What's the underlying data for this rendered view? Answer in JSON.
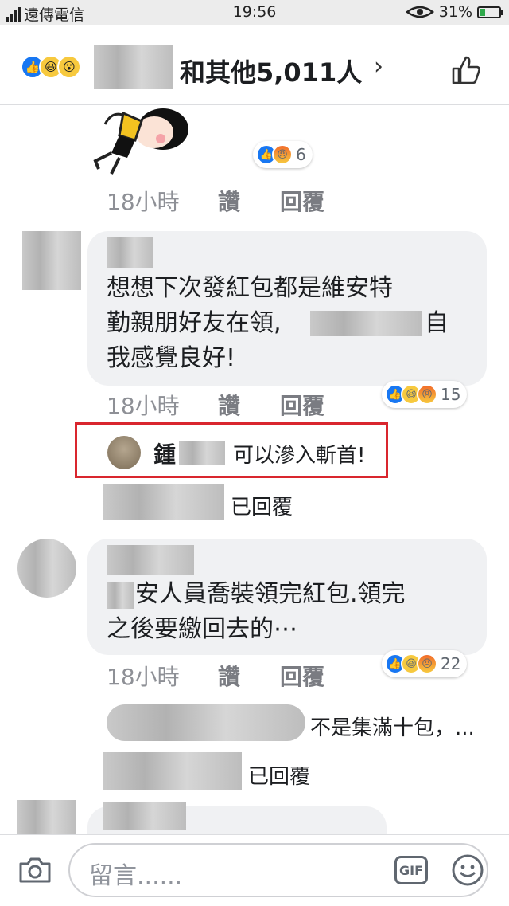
{
  "status_bar": {
    "carrier": "遠傳電信",
    "time": "19:56",
    "battery": "31%",
    "battery_fraction": 0.31
  },
  "header": {
    "likes_summary": "和其他5,011人",
    "chevron": "›",
    "reactions": [
      "like-icon",
      "haha-icon",
      "wow-icon"
    ]
  },
  "comments": [
    {
      "time": "18小時",
      "like_label": "讚",
      "reply_label": "回覆",
      "reaction_count": "6",
      "reactions": [
        "like-icon",
        "angry-icon"
      ]
    },
    {
      "line1": "想想下次發紅包都是維安特",
      "line2a": "勤親朋好友在領,",
      "line2b": "自",
      "line3": "我感覺良好!",
      "time": "18小時",
      "like_label": "讚",
      "reply_label": "回覆",
      "reaction_count": "15",
      "reactions": [
        "like-icon",
        "haha-icon",
        "angry-icon"
      ],
      "highlight_reply": {
        "name": "鍾",
        "text": "可以滲入斬首!"
      },
      "replied": "已回覆"
    },
    {
      "line1": "安人員喬裝領完紅包.領完",
      "line2": "之後要繳回去的⋯",
      "time": "18小時",
      "like_label": "讚",
      "reply_label": "回覆",
      "reaction_count": "22",
      "reactions": [
        "like-icon",
        "haha-icon",
        "angry-icon"
      ],
      "reply_preview": "不是集滿十包，...",
      "replied": "已回覆"
    }
  ],
  "composer": {
    "placeholder": "留言......",
    "gif_label": "GIF"
  }
}
